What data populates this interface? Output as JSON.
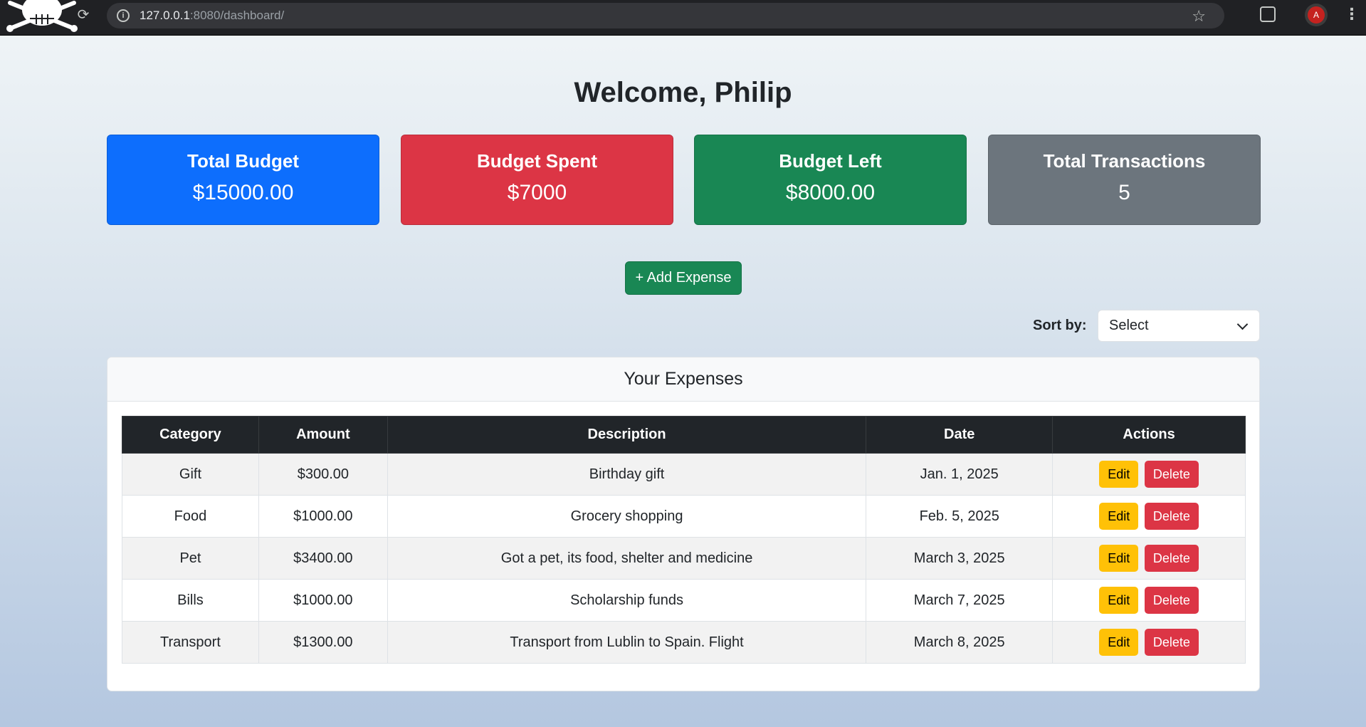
{
  "browser": {
    "url_host": "127.0.0.1",
    "url_path": ":8080/dashboard/"
  },
  "page": {
    "title": "Welcome, Philip"
  },
  "cards": [
    {
      "label": "Total Budget",
      "value": "$15000.00",
      "color": "#0d6efd"
    },
    {
      "label": "Budget Spent",
      "value": "$7000",
      "color": "#dc3545"
    },
    {
      "label": "Budget Left",
      "value": "$8000.00",
      "color": "#198754"
    },
    {
      "label": "Total Transactions",
      "value": "5",
      "color": "#6c757d"
    }
  ],
  "actions": {
    "add_expense_label": "+ Add Expense"
  },
  "sort": {
    "label": "Sort by:",
    "selected": "Select"
  },
  "expenses": {
    "title": "Your Expenses",
    "columns": [
      "Category",
      "Amount",
      "Description",
      "Date",
      "Actions"
    ],
    "rows": [
      {
        "category": "Gift",
        "amount": "$300.00",
        "description": "Birthday gift",
        "date": "Jan. 1, 2025"
      },
      {
        "category": "Food",
        "amount": "$1000.00",
        "description": "Grocery shopping",
        "date": "Feb. 5, 2025"
      },
      {
        "category": "Pet",
        "amount": "$3400.00",
        "description": "Got a pet, its food, shelter and medicine",
        "date": "March 3, 2025"
      },
      {
        "category": "Bills",
        "amount": "$1000.00",
        "description": "Scholarship funds",
        "date": "March 7, 2025"
      },
      {
        "category": "Transport",
        "amount": "$1300.00",
        "description": "Transport from Lublin to Spain. Flight",
        "date": "March 8, 2025"
      }
    ],
    "edit_label": "Edit",
    "delete_label": "Delete"
  },
  "profile": {
    "initial": "A"
  }
}
